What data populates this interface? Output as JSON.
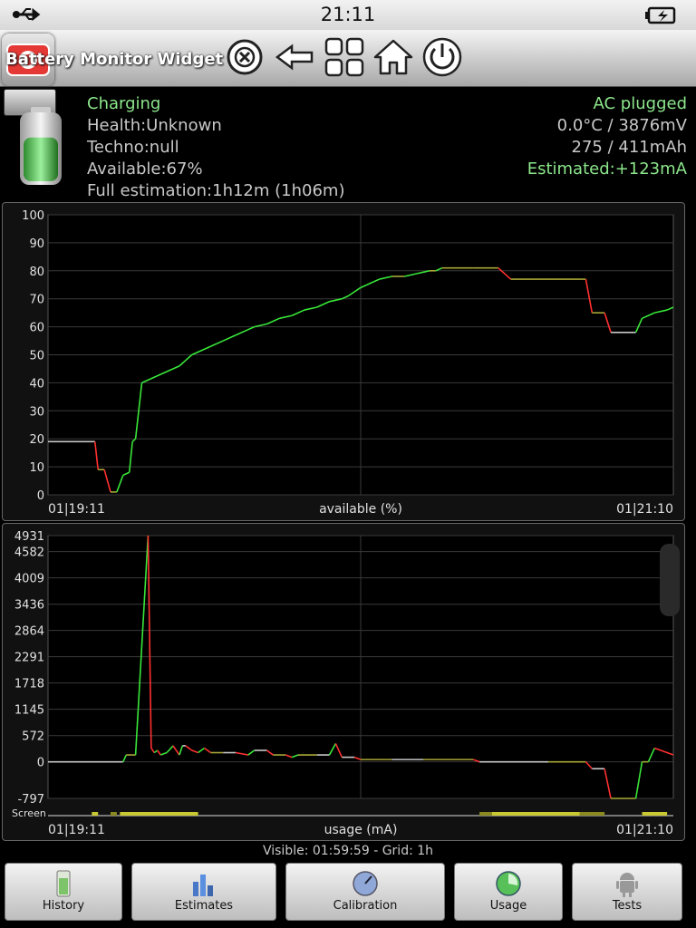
{
  "status_bar": {
    "time": "21:11",
    "usb_icon": "usb-icon",
    "battery_icon": "battery-charging-icon"
  },
  "app": {
    "title": "Battery Monitor Widget Pro"
  },
  "toolbar": {
    "close_icon": "close-circle-icon",
    "back_icon": "back-arrow-icon",
    "apps_icon": "grid-icon",
    "home_icon": "home-icon",
    "power_icon": "power-icon"
  },
  "info": {
    "status": "Charging",
    "health": "Health:Unknown",
    "techno": "Techno:null",
    "available": "Available:67%",
    "full_estimation": "Full estimation:1h12m (1h06m)",
    "plug": "AC plugged",
    "temp_voltage": "0.0°C / 3876mV",
    "capacity": "275 / 411mAh",
    "estimated": "Estimated:+123mA",
    "battery_level": 67
  },
  "chart_data": [
    {
      "type": "line",
      "xlabel": "available (%)",
      "x_start": "01|19:11",
      "x_end": "01|21:10",
      "ylim": [
        0,
        100
      ],
      "yticks": [
        "100",
        "90",
        "80",
        "70",
        "60",
        "50",
        "40",
        "30",
        "20",
        "10",
        "0"
      ],
      "grid": true,
      "series": [
        {
          "values": [
            [
              0,
              19
            ],
            [
              0.075,
              19
            ],
            [
              0.08,
              9
            ],
            [
              0.09,
              9
            ],
            [
              0.1,
              1
            ],
            [
              0.11,
              1
            ],
            [
              0.12,
              7
            ],
            [
              0.13,
              8
            ],
            [
              0.135,
              19
            ],
            [
              0.14,
              20
            ],
            [
              0.15,
              40
            ],
            [
              0.18,
              43
            ],
            [
              0.21,
              46
            ],
            [
              0.22,
              48
            ],
            [
              0.23,
              50
            ],
            [
              0.26,
              53
            ],
            [
              0.28,
              55
            ],
            [
              0.3,
              57
            ],
            [
              0.32,
              59
            ],
            [
              0.33,
              60
            ],
            [
              0.35,
              61
            ],
            [
              0.37,
              63
            ],
            [
              0.39,
              64
            ],
            [
              0.41,
              66
            ],
            [
              0.43,
              67
            ],
            [
              0.45,
              69
            ],
            [
              0.47,
              70
            ],
            [
              0.48,
              71
            ],
            [
              0.5,
              74
            ],
            [
              0.51,
              75
            ],
            [
              0.52,
              76
            ],
            [
              0.53,
              77
            ],
            [
              0.55,
              78
            ],
            [
              0.57,
              78
            ],
            [
              0.59,
              79
            ],
            [
              0.61,
              80
            ],
            [
              0.62,
              80
            ],
            [
              0.63,
              81
            ],
            [
              0.68,
              81
            ],
            [
              0.72,
              81
            ],
            [
              0.74,
              77
            ],
            [
              0.85,
              77
            ],
            [
              0.86,
              77
            ],
            [
              0.87,
              65
            ],
            [
              0.89,
              65
            ],
            [
              0.9,
              58
            ],
            [
              0.94,
              58
            ],
            [
              0.95,
              63
            ],
            [
              0.97,
              65
            ],
            [
              0.99,
              66
            ],
            [
              1,
              67
            ]
          ]
        }
      ]
    },
    {
      "type": "line",
      "xlabel": "usage (mA)",
      "x_start": "01|19:11",
      "x_end": "01|21:10",
      "ylim": [
        -797,
        4931
      ],
      "yticks": [
        "4931",
        "4582",
        "4009",
        "3436",
        "2864",
        "2291",
        "1718",
        "1145",
        "572",
        "0",
        "-797"
      ],
      "yvalues": [
        4931,
        4582,
        4009,
        3436,
        2864,
        2291,
        1718,
        1145,
        572,
        0,
        -797
      ],
      "grid": true,
      "screen_label": "Screen",
      "series": [
        {
          "values": [
            [
              0,
              0
            ],
            [
              0.12,
              0
            ],
            [
              0.125,
              150
            ],
            [
              0.14,
              150
            ],
            [
              0.16,
              4931
            ],
            [
              0.165,
              300
            ],
            [
              0.17,
              200
            ],
            [
              0.175,
              250
            ],
            [
              0.18,
              150
            ],
            [
              0.19,
              200
            ],
            [
              0.2,
              350
            ],
            [
              0.21,
              150
            ],
            [
              0.215,
              350
            ],
            [
              0.22,
              350
            ],
            [
              0.23,
              250
            ],
            [
              0.24,
              200
            ],
            [
              0.25,
              300
            ],
            [
              0.26,
              200
            ],
            [
              0.28,
              200
            ],
            [
              0.3,
              200
            ],
            [
              0.32,
              150
            ],
            [
              0.33,
              250
            ],
            [
              0.35,
              250
            ],
            [
              0.36,
              150
            ],
            [
              0.38,
              150
            ],
            [
              0.39,
              100
            ],
            [
              0.4,
              150
            ],
            [
              0.43,
              150
            ],
            [
              0.45,
              150
            ],
            [
              0.46,
              400
            ],
            [
              0.47,
              100
            ],
            [
              0.49,
              100
            ],
            [
              0.5,
              50
            ],
            [
              0.55,
              50
            ],
            [
              0.6,
              50
            ],
            [
              0.68,
              50
            ],
            [
              0.69,
              0
            ],
            [
              0.8,
              0
            ],
            [
              0.86,
              0
            ],
            [
              0.87,
              -150
            ],
            [
              0.89,
              -150
            ],
            [
              0.9,
              -797
            ],
            [
              0.94,
              -797
            ],
            [
              0.95,
              0
            ],
            [
              0.96,
              0
            ],
            [
              0.97,
              300
            ],
            [
              1,
              150
            ]
          ]
        }
      ]
    }
  ],
  "footer": {
    "visible": "Visible: 01:59:59 - Grid: 1h"
  },
  "nav": {
    "history": "History",
    "estimates": "Estimates",
    "calibration": "Calibration",
    "usage": "Usage",
    "tests": "Tests"
  }
}
